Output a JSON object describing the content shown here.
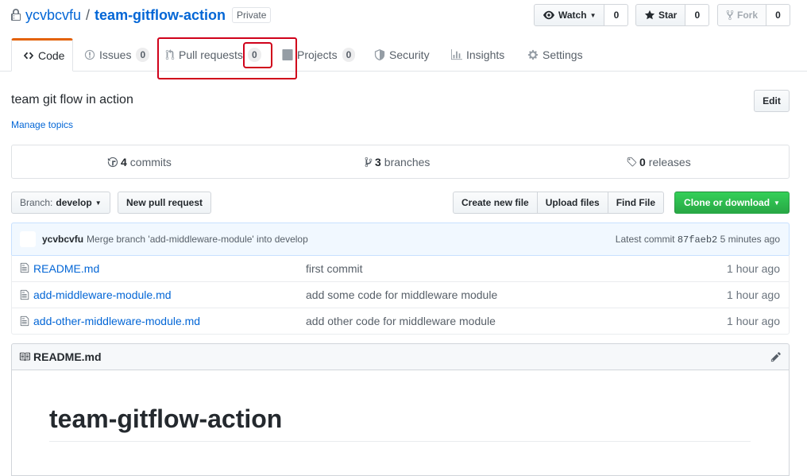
{
  "repo": {
    "owner": "ycvbcvfu",
    "separator": "/",
    "name": "team-gitflow-action",
    "visibility": "Private"
  },
  "actions": {
    "watch_label": "Watch",
    "watch_count": "0",
    "star_label": "Star",
    "star_count": "0",
    "fork_label": "Fork",
    "fork_count": "0"
  },
  "tabs": [
    {
      "label": "Code",
      "icon": "code-icon",
      "selected": true
    },
    {
      "label": "Issues",
      "icon": "issue-icon",
      "count": "0"
    },
    {
      "label": "Pull requests",
      "icon": "pull-request-icon",
      "count": "0"
    },
    {
      "label": "Projects",
      "icon": "project-icon",
      "count": "0"
    },
    {
      "label": "Security",
      "icon": "shield-icon"
    },
    {
      "label": "Insights",
      "icon": "graph-icon"
    },
    {
      "label": "Settings",
      "icon": "gear-icon"
    }
  ],
  "description": {
    "text": "team git flow in action",
    "manage_topics": "Manage topics",
    "edit_label": "Edit"
  },
  "summary": {
    "commits_count": "4",
    "commits_label": "commits",
    "branches_count": "3",
    "branches_label": "branches",
    "releases_count": "0",
    "releases_label": "releases"
  },
  "file_nav": {
    "branch_prefix": "Branch:",
    "branch_name": "develop",
    "new_pull_request": "New pull request",
    "create_new_file": "Create new file",
    "upload_files": "Upload files",
    "find_file": "Find File",
    "clone_or_download": "Clone or download"
  },
  "latest_commit": {
    "author": "ycvbcvfu",
    "message": "Merge branch 'add-middleware-module' into develop",
    "prefix": "Latest commit",
    "sha": "87faeb2",
    "age": "5 minutes ago"
  },
  "files": [
    {
      "name": "README.md",
      "message": "first commit",
      "age": "1 hour ago"
    },
    {
      "name": "add-middleware-module.md",
      "message": "add some code for middleware module",
      "age": "1 hour ago"
    },
    {
      "name": "add-other-middleware-module.md",
      "message": "add other code for middleware module",
      "age": "1 hour ago"
    }
  ],
  "readme": {
    "filename": "README.md",
    "heading": "team-gitflow-action"
  },
  "colors": {
    "link": "#0366d6",
    "tab_accent": "#e36209",
    "highlight": "#d0021b",
    "clone_button": "#28a745"
  }
}
